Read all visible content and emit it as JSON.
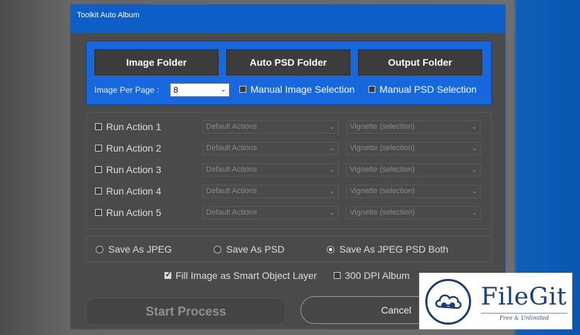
{
  "window": {
    "title": "Toolkit Auto Album"
  },
  "folders": {
    "image_folder": "Image Folder",
    "auto_psd_folder": "Auto PSD Folder",
    "output_folder": "Output Folder"
  },
  "per_page": {
    "label": "Image Per Page :",
    "value": "8",
    "manual_image_selection": "Manual Image Selection",
    "manual_psd_selection": "Manual PSD Selection"
  },
  "actions": [
    {
      "label": "Run Action 1",
      "set": "Default Actions",
      "action": "Vignette (selection)"
    },
    {
      "label": "Run Action 2",
      "set": "Default Actions",
      "action": "Vignette (selection)"
    },
    {
      "label": "Run Action 3",
      "set": "Default Actions",
      "action": "Vignette (selection)"
    },
    {
      "label": "Run Action 4",
      "set": "Default Actions",
      "action": "Vignette (selection)"
    },
    {
      "label": "Run Action 5",
      "set": "Default Actions",
      "action": "Vignette (selection)"
    }
  ],
  "save": {
    "jpeg": "Save As JPEG",
    "psd": "Save As PSD",
    "both": "Save As JPEG PSD Both",
    "selected": "both"
  },
  "options": {
    "smart_object": "Fill Image as Smart Object Layer",
    "smart_object_checked": true,
    "dpi300": "300 DPI Album",
    "dpi300_checked": false
  },
  "buttons": {
    "start": "Start Process",
    "cancel": "Cancel"
  },
  "watermark": {
    "name": "FileGit",
    "tagline": "Free & Unlimited"
  },
  "colors": {
    "title_bar": "#0b5fc6",
    "folder_panel": "#1767dd",
    "dialog_bg": "#4a4a4a",
    "watermark_blue": "#1b3f7a"
  }
}
